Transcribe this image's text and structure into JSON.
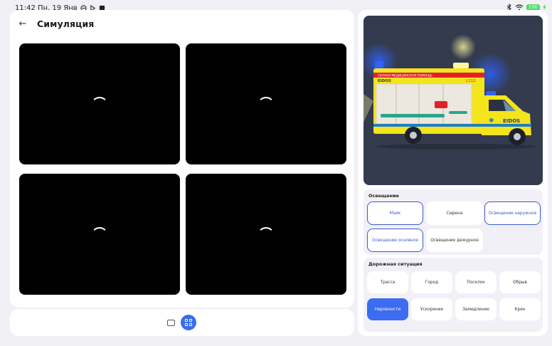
{
  "status": {
    "time_date": "11:42 Пн, 19 Янв",
    "battery": "100"
  },
  "header": {
    "title": "Симуляция"
  },
  "lighting": {
    "title": "Освещение",
    "buttons": [
      "Маяк",
      "Сирена",
      "Освещение наружное",
      "Освещение основное",
      "Освещение дежурное"
    ]
  },
  "road": {
    "title": "Дорожная ситуация",
    "buttons": [
      "Трасса",
      "Город",
      "Поселок",
      "Обрыв",
      "Неровности",
      "Ускорение",
      "Замедление",
      "Крен"
    ]
  },
  "vehicle": {
    "stripe": "СКОРАЯ МЕДИЦИНСКАЯ ПОМОЩЬ",
    "brand": "EIDOS",
    "unit": "L112",
    "brand_side": "EIDOS"
  },
  "colors": {
    "accent": "#3b6cf1",
    "scene_bg": "#343b4e",
    "vehicle_yellow": "#f3e41c",
    "stripe_red": "#e02228"
  }
}
